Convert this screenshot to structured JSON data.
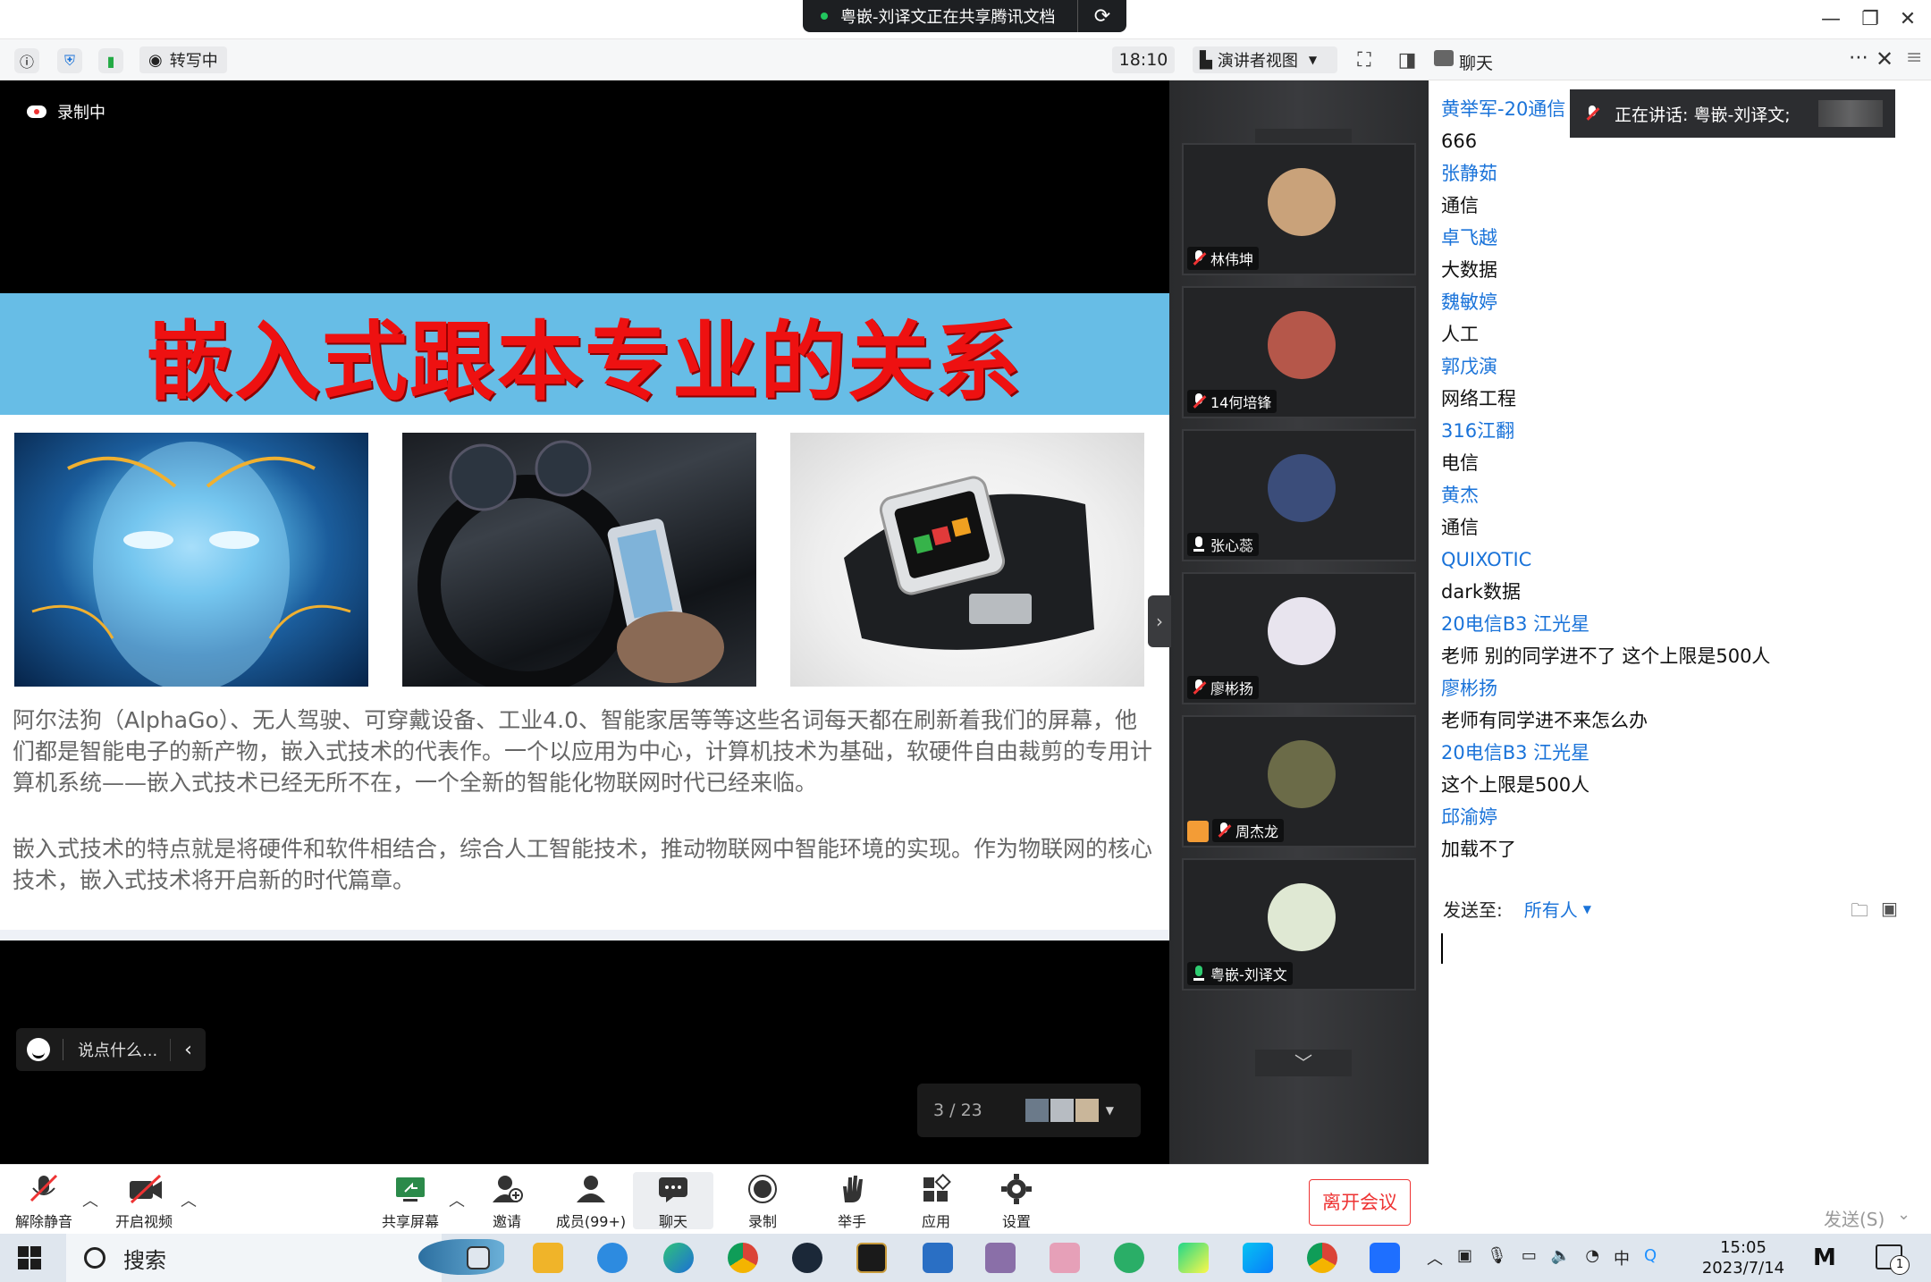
{
  "share_banner": {
    "text": "粤嵌-刘译文正在共享腾讯文档"
  },
  "toolbar": {
    "transcribe_label": "转写中",
    "elapsed_time": "18:10",
    "view_label": "演讲者视图"
  },
  "chat_header": {
    "title": "聊天"
  },
  "stage": {
    "recording_label": "录制中",
    "comment_placeholder": "说点什么...",
    "page_indicator": "3 / 23"
  },
  "slide": {
    "title": "嵌入式跟本专业的关系",
    "paragraph1": "阿尔法狗（AlphaGo）、无人驾驶、可穿戴设备、工业4.0、智能家居等等这些名词每天都在刷新着我们的屏幕，他们都是智能电子的新产物，嵌入式技术的代表作。一个以应用为中心，计算机技术为基础，软硬件自由裁剪的专用计算机系统——嵌入式技术已经无所不在，一个全新的智能化物联网时代已经来临。",
    "paragraph2": "嵌入式技术的特点就是将硬件和软件相结合，综合人工智能技术，推动物联网中智能环境的实现。作为物联网的核心技术，嵌入式技术将开启新的时代篇章。"
  },
  "participants": [
    {
      "name": "林伟坤",
      "mic": "muted",
      "avatar_color": "#c9a27a"
    },
    {
      "name": "14何培锋",
      "mic": "muted",
      "avatar_color": "#b5574a"
    },
    {
      "name": "张心蕊",
      "mic": "on-white",
      "avatar_color": "#3b4d7a"
    },
    {
      "name": "廖彬扬",
      "mic": "muted",
      "avatar_color": "#e8e4ee"
    },
    {
      "name": "周杰龙",
      "mic": "muted",
      "avatar_color": "#6b6b48",
      "host": true
    },
    {
      "name": "粤嵌-刘译文",
      "mic": "on",
      "avatar_color": "#dfe8d3"
    }
  ],
  "speaking_banner": {
    "text": "正在讲话: 粤嵌-刘译文;"
  },
  "chat": {
    "messages": [
      {
        "sender": "黄举军-20通信",
        "text": "666"
      },
      {
        "sender": "张静茹",
        "text": "通信"
      },
      {
        "sender": "卓飞越",
        "text": "大数据"
      },
      {
        "sender": "魏敏婷",
        "text": "人工"
      },
      {
        "sender": "郭戊演",
        "text": "网络工程"
      },
      {
        "sender": "316江翻",
        "text": "电信"
      },
      {
        "sender": "黄杰",
        "text": "通信"
      },
      {
        "sender": "QUIXOTIC",
        "text": "dark数据"
      },
      {
        "sender": "20电信B3 江光星",
        "text": "老师 别的同学进不了 这个上限是500人"
      },
      {
        "sender": "廖彬扬",
        "text": "老师有同学进不来怎么办"
      },
      {
        "sender": "20电信B3 江光星",
        "text": "这个上限是500人"
      },
      {
        "sender": "邱渝婷",
        "text": "加载不了"
      }
    ],
    "send_to_label": "发送至:",
    "send_to_target": "所有人",
    "send_button": "发送(S)"
  },
  "controls": {
    "unmute": "解除静音",
    "start_video": "开启视频",
    "share_screen": "共享屏幕",
    "invite": "邀请",
    "members": "成员(99+)",
    "chat": "聊天",
    "record": "录制",
    "raise_hand": "举手",
    "apps": "应用",
    "settings": "设置",
    "leave": "离开会议"
  },
  "taskbar": {
    "search_label": "搜索",
    "time": "15:05",
    "date": "2023/7/14",
    "notification_count": "1",
    "ime_label": "中"
  },
  "colors": {
    "accent_blue": "#1a73d9",
    "leave_red": "#e33333",
    "slide_banner": "#67bde6",
    "slide_title": "#ee1111"
  }
}
